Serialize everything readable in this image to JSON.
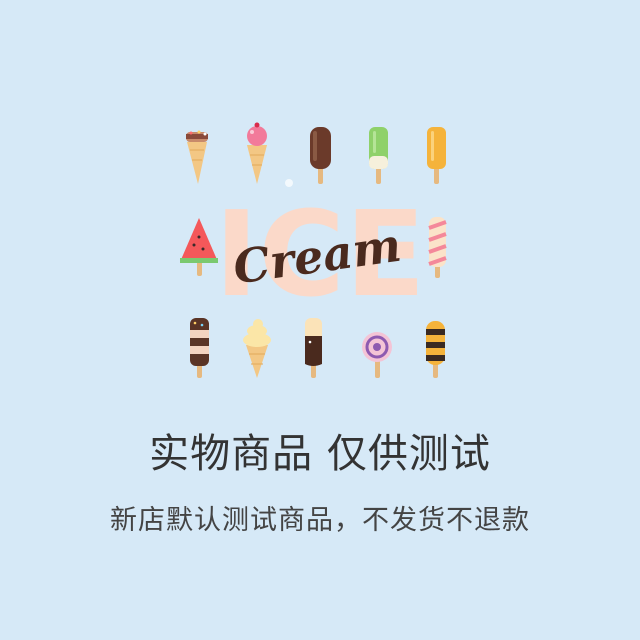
{
  "logo": {
    "main_text": "ICE",
    "script_text": "Cream",
    "main_color": "#fbd9c9",
    "script_color": "#4a2a1e"
  },
  "icons": [
    "cone-sprinkles-icon",
    "cone-scoop-icon",
    "chocolate-popsicle-icon",
    "green-popsicle-icon",
    "orange-popsicle-icon",
    "watermelon-popsicle-icon",
    "striped-popsicle-icon",
    "wafer-popsicle-icon",
    "soft-serve-cone-icon",
    "dipped-popsicle-icon",
    "swirl-lollipop-icon",
    "bee-popsicle-icon"
  ],
  "caption": {
    "headline": "实物商品 仅供测试",
    "subline": "新店默认测试商品，不发货不退款"
  },
  "colors": {
    "background": "#d6e9f7",
    "text": "#333333"
  }
}
